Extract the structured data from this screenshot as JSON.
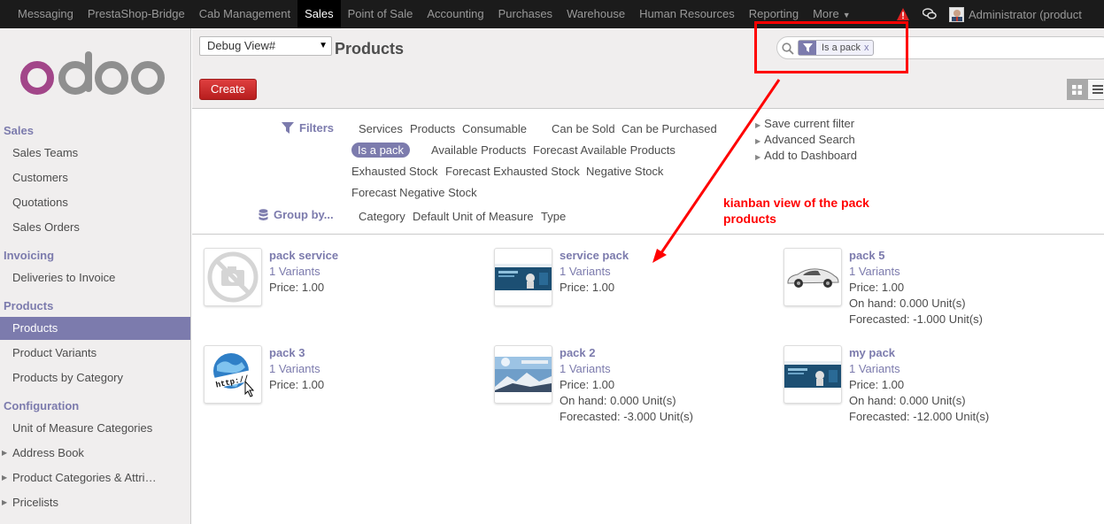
{
  "topbar": {
    "menu": [
      {
        "label": "Messaging",
        "active": false
      },
      {
        "label": "PrestaShop-Bridge",
        "active": false
      },
      {
        "label": "Cab Management",
        "active": false
      },
      {
        "label": "Sales",
        "active": true
      },
      {
        "label": "Point of Sale",
        "active": false
      },
      {
        "label": "Accounting",
        "active": false
      },
      {
        "label": "Purchases",
        "active": false
      },
      {
        "label": "Warehouse",
        "active": false
      },
      {
        "label": "Human Resources",
        "active": false
      },
      {
        "label": "Reporting",
        "active": false
      },
      {
        "label": "More",
        "active": false
      }
    ],
    "user": "Administrator (product"
  },
  "sidebar": {
    "sections": [
      {
        "title": "Sales",
        "items": [
          "Sales Teams",
          "Customers",
          "Quotations",
          "Sales Orders"
        ]
      },
      {
        "title": "Invoicing",
        "items": [
          "Deliveries to Invoice"
        ]
      },
      {
        "title": "Products",
        "items": [
          "Products",
          "Product Variants",
          "Products by Category"
        ]
      },
      {
        "title": "Configuration",
        "items": [
          "Unit of Measure Categories",
          "Address Book",
          "Product Categories & Attri…",
          "Pricelists"
        ]
      }
    ],
    "active_item": "Products"
  },
  "control": {
    "debug_select": "Debug View#",
    "breadcrumb": "Products",
    "create_label": "Create",
    "search_facet": "Is a pack",
    "facet_close": "x"
  },
  "filters": {
    "filters_label": "Filters",
    "groupby_label": "Group by...",
    "options": {
      "services": "Services",
      "products": "Products",
      "consumable": "Consumable",
      "can_be_sold": "Can be Sold",
      "can_be_purchased": "Can be Purchased",
      "is_a_pack": "Is a pack",
      "available": "Available Products",
      "forecast_available": "Forecast Available Products",
      "exhausted": "Exhausted Stock",
      "forecast_exhausted": "Forecast Exhausted Stock",
      "negative": "Negative Stock",
      "forecast_negative": "Forecast Negative Stock"
    },
    "groupby": {
      "category": "Category",
      "uom": "Default Unit of Measure",
      "type": "Type"
    },
    "right": {
      "save": "Save current filter",
      "advanced": "Advanced Search",
      "dashboard": "Add to Dashboard"
    }
  },
  "annotation": {
    "line1": "kianban view of the pack",
    "line2": "products"
  },
  "products": [
    {
      "name": "pack service",
      "variants": "1 Variants",
      "price": "Price: 1.00",
      "on_hand": "",
      "forecast": "",
      "image": "no-image-camera-icon"
    },
    {
      "name": "service pack",
      "variants": "1 Variants",
      "price": "Price: 1.00",
      "on_hand": "",
      "forecast": "",
      "image": "website-screenshot-thumbnail"
    },
    {
      "name": "pack 5",
      "variants": "1 Variants",
      "price": "Price: 1.00",
      "on_hand": "On hand: 0.000 Unit(s)",
      "forecast": "Forecasted: -1.000 Unit(s)",
      "image": "car-thumbnail"
    },
    {
      "name": "pack 3",
      "variants": "1 Variants",
      "price": "Price: 1.00",
      "on_hand": "",
      "forecast": "",
      "image": "globe-http-thumbnail"
    },
    {
      "name": "pack 2",
      "variants": "1 Variants",
      "price": "Price: 1.00",
      "on_hand": "On hand: 0.000 Unit(s)",
      "forecast": "Forecasted: -3.000 Unit(s)",
      "image": "mountain-snow-thumbnail"
    },
    {
      "name": "my pack",
      "variants": "1 Variants",
      "price": "Price: 1.00",
      "on_hand": "On hand: 0.000 Unit(s)",
      "forecast": "Forecasted: -12.000 Unit(s)",
      "image": "website-screenshot-thumbnail"
    }
  ],
  "colors": {
    "accent": "#7c7bad",
    "create": "#d23a3a",
    "annotation": "#ff0000"
  }
}
